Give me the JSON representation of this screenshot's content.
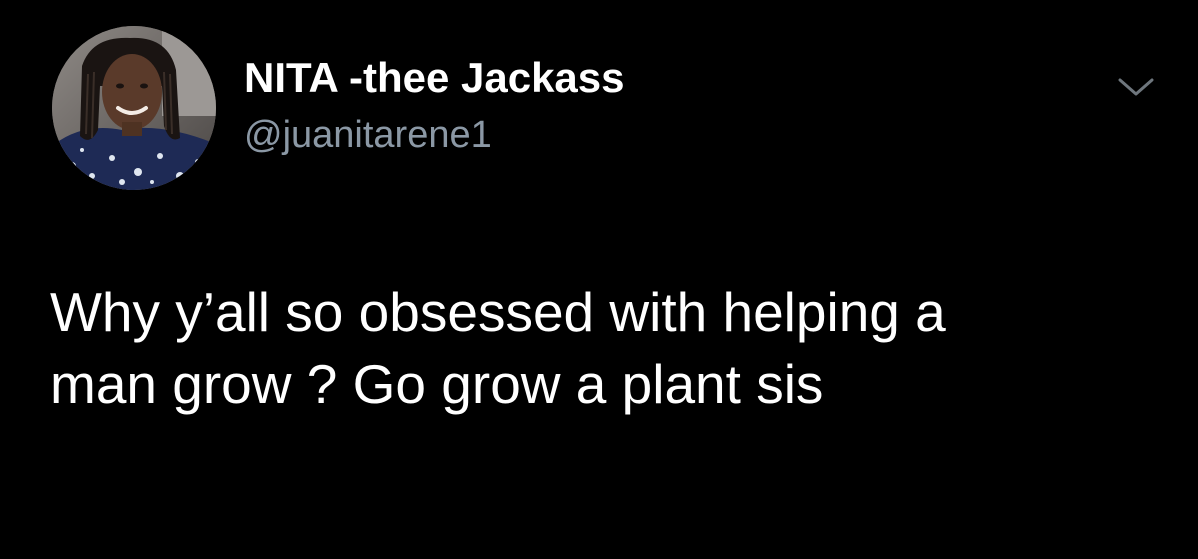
{
  "tweet": {
    "author": {
      "display_name": "NITA -thee Jackass",
      "handle": "@juanitarene1",
      "avatar_icon": "profile-photo"
    },
    "menu_icon": "chevron-down-icon",
    "text": "Why y’all so obsessed with helping a\nman grow ?  Go grow a plant sis"
  },
  "colors": {
    "background": "#000000",
    "primary_text": "#ffffff",
    "secondary_text": "#8b98a5",
    "chevron": "#6e767d"
  }
}
